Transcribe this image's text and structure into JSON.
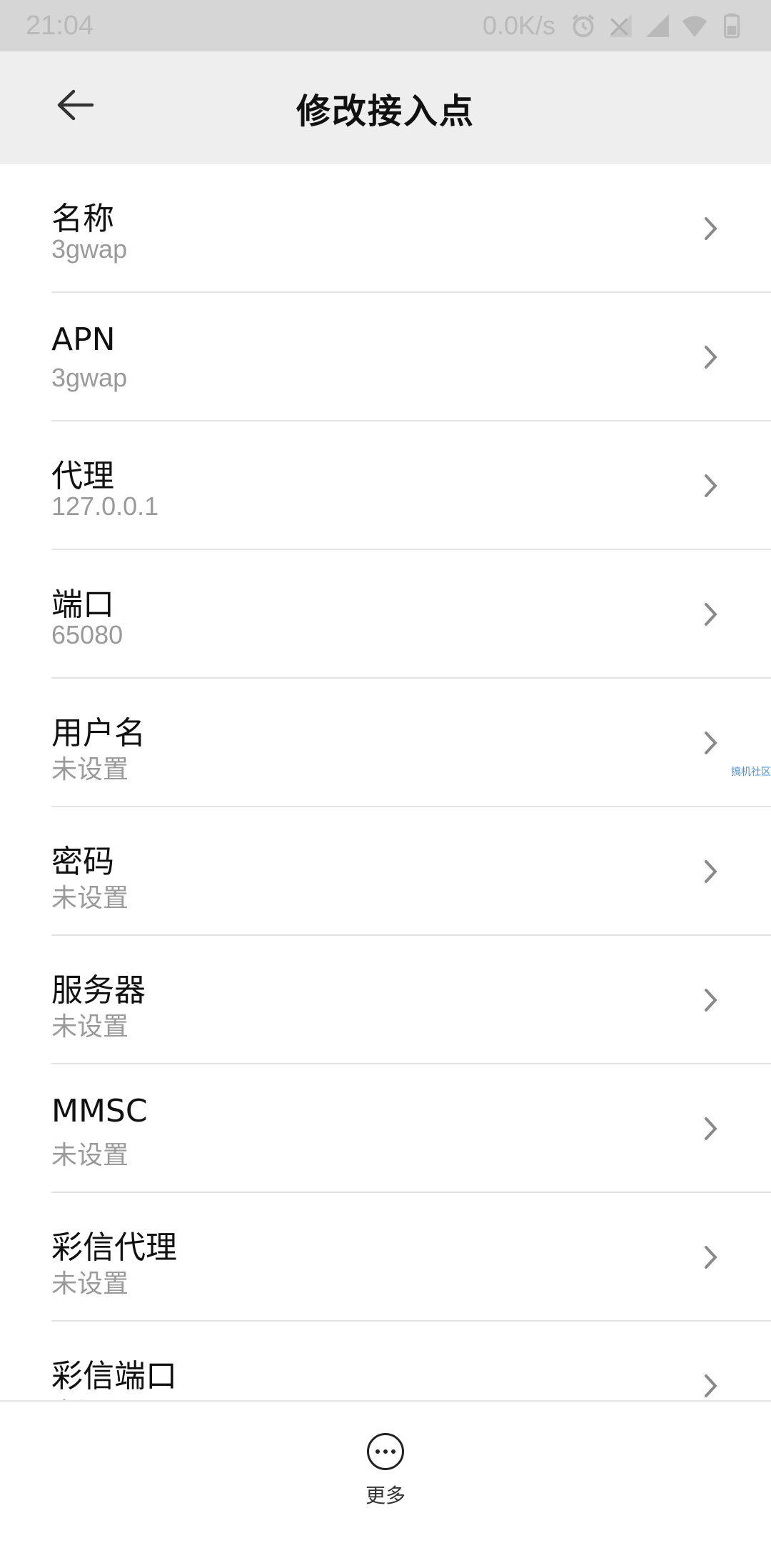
{
  "status_bar": {
    "time": "21:04",
    "speed": "0.0K/s",
    "icons": [
      "alarm-icon",
      "signal-off-icon",
      "signal-icon",
      "wifi-icon",
      "battery-icon"
    ]
  },
  "header": {
    "title": "修改接入点",
    "back_icon": "back-arrow-icon"
  },
  "apn_fields": [
    {
      "label": "名称",
      "value": "3gwap"
    },
    {
      "label": "APN",
      "value": "3gwap"
    },
    {
      "label": "代理",
      "value": "127.0.0.1"
    },
    {
      "label": "端口",
      "value": "65080"
    },
    {
      "label": "用户名",
      "value": "未设置"
    },
    {
      "label": "密码",
      "value": "未设置"
    },
    {
      "label": "服务器",
      "value": "未设置"
    },
    {
      "label": "MMSC",
      "value": "未设置"
    },
    {
      "label": "彩信代理",
      "value": "未设置"
    },
    {
      "label": "彩信端口",
      "value": "未设置"
    }
  ],
  "watermark": "搞机社区",
  "footer": {
    "more_label": "更多"
  },
  "colors": {
    "status_bar_bg": "#d6d6d6",
    "header_bg": "#eeeeee",
    "secondary_text": "#9a9a9a",
    "divider": "#e2e2e2"
  }
}
